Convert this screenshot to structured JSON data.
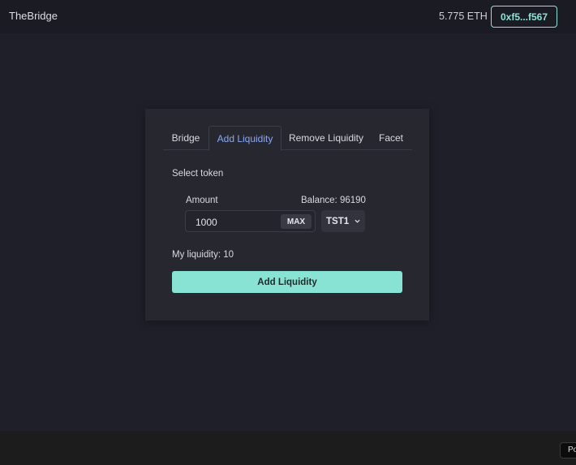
{
  "header": {
    "app_title": "TheBridge",
    "balance": "5.775 ETH",
    "wallet_address": "0xf5...f567"
  },
  "tabs": [
    {
      "label": "Bridge",
      "active": false
    },
    {
      "label": "Add Liquidity",
      "active": true
    },
    {
      "label": "Remove Liquidity",
      "active": false
    },
    {
      "label": "Facet",
      "active": false
    }
  ],
  "form": {
    "select_token_label": "Select token",
    "amount_label": "Amount",
    "balance_label": "Balance: 96190",
    "amount_value": "1000",
    "max_label": "MAX",
    "token_selected": "TST1",
    "my_liquidity": "My liquidity: 10",
    "submit_label": "Add Liquidity"
  },
  "footer": {
    "button_label": "Po"
  },
  "colors": {
    "accent": "#88e3d4",
    "active_tab": "#8aa8f0",
    "background": "#1f1f29",
    "card": "#272730"
  }
}
